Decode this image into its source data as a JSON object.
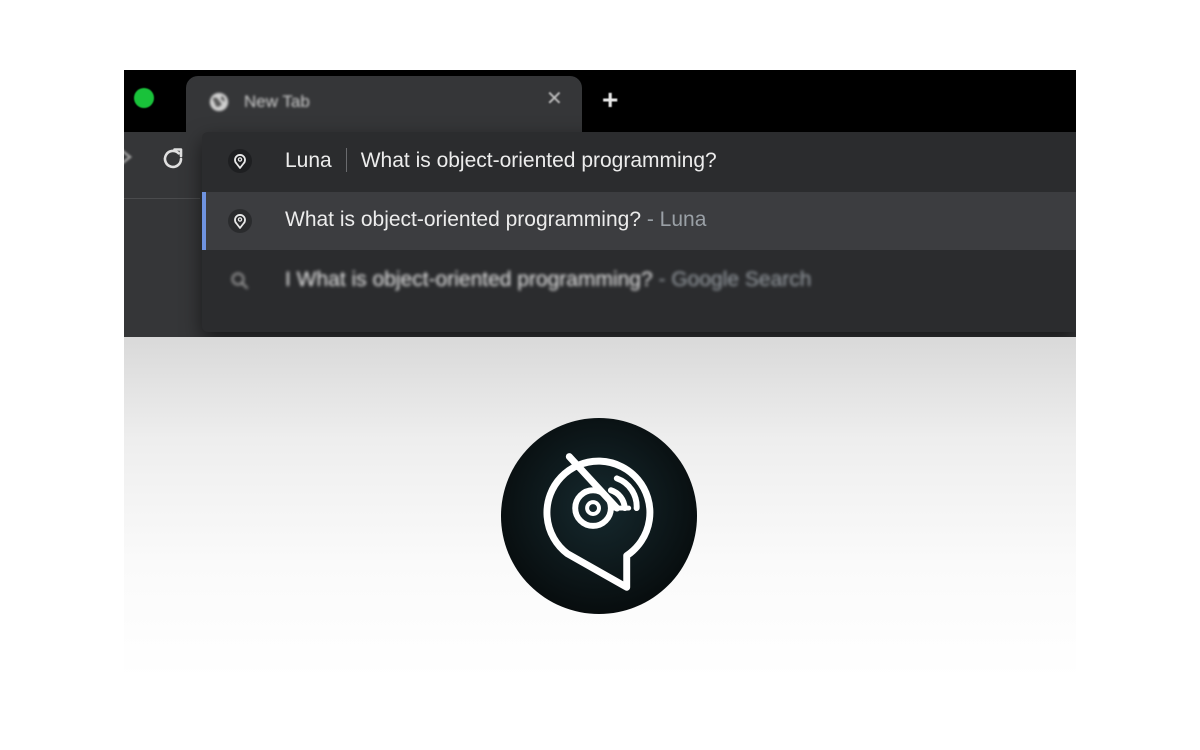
{
  "tab": {
    "title": "New Tab",
    "close_glyph": "✕",
    "favicon": "globe-icon"
  },
  "toolbar": {
    "newtab_glyph": "+",
    "forward_icon": "forward-arrow-icon",
    "reload_icon": "reload-icon"
  },
  "omnibox": {
    "keyword": "Luna",
    "query": "What is object-oriented programming?",
    "suggestions": [
      {
        "text": "What is object-oriented programming?",
        "suffix": "- Luna",
        "icon": "luna-icon",
        "selected": true
      },
      {
        "text": "I What is object-oriented programming?",
        "suffix": "- Google Search",
        "icon": "search-icon",
        "selected": false
      }
    ]
  },
  "page": {
    "logo": "luna-logo"
  },
  "colors": {
    "tab_bg": "#353638",
    "dropdown_bg": "#2b2c2e",
    "selected_row_bg": "#3c3d40",
    "accent": "#6f93e0",
    "traffic_green": "#19c23a"
  }
}
